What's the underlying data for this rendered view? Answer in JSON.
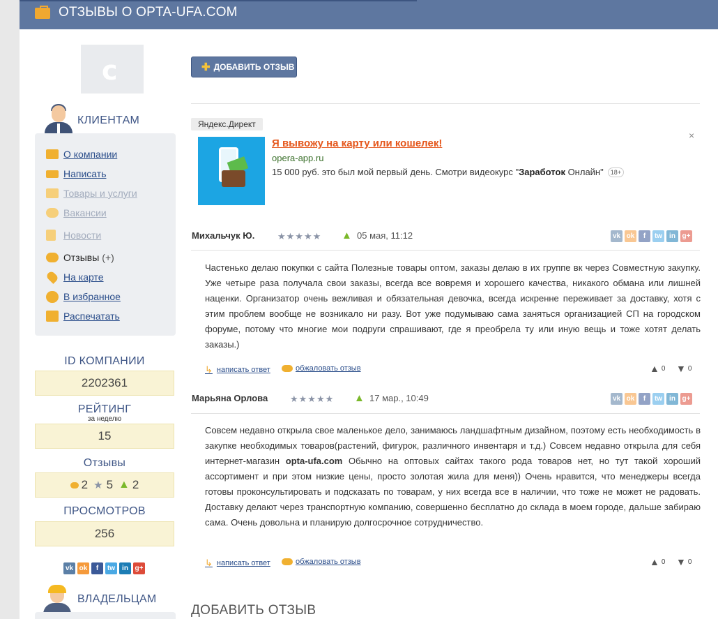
{
  "header": {
    "title": "ОТЗЫВЫ О OPTA-UFA.COM"
  },
  "logo": {
    "letter": "c"
  },
  "clients": {
    "title": "КЛИЕНТАМ",
    "items": [
      {
        "label": "О компании",
        "icon": "briefcase-icon",
        "state": "link"
      },
      {
        "label": "Написать",
        "icon": "envelope-icon",
        "state": "link"
      },
      {
        "label": "Товары и услуги",
        "icon": "camera-icon",
        "state": "disabled"
      },
      {
        "label": "Вакансии",
        "icon": "people-icon",
        "state": "disabled"
      },
      {
        "label": "Новости",
        "icon": "newspaper-icon",
        "state": "disabled"
      },
      {
        "label": "Отзывы",
        "count": "(+)",
        "icon": "chat-bubble-icon",
        "state": "current"
      },
      {
        "label": "На карте",
        "icon": "map-pin-icon",
        "state": "link"
      },
      {
        "label": "В избранное",
        "icon": "star-burst-icon",
        "state": "link"
      },
      {
        "label": "Распечатать",
        "icon": "printer-icon",
        "state": "link"
      }
    ]
  },
  "stats": {
    "id_label": "ID КОМПАНИИ",
    "id_value": "2202361",
    "rating_label": "РЕЙТИНГ",
    "rating_sub": "за неделю",
    "rating_value": "15",
    "reviews_label": "Отзывы",
    "reviews_comments": "2",
    "reviews_stars": "5",
    "reviews_likes": "2",
    "views_label": "ПРОСМОТРОВ",
    "views_value": "256"
  },
  "owners": {
    "title": "ВЛАДЕЛЬЦАМ"
  },
  "social": [
    "vk",
    "ok",
    "f",
    "tw",
    "in",
    "g+"
  ],
  "add_button": {
    "label": "ДОБАВИТЬ ОТЗЫВ"
  },
  "ad": {
    "tag": "Яндекс.Директ",
    "title": "Я вывожу на карту или кошелек!",
    "domain": "opera-app.ru",
    "text_before": "15 000 руб. это был мой первый день. Смотри видеокурс \"",
    "text_bold": "Заработок",
    "text_after": " Онлайн\"",
    "age": "18+",
    "close": "×"
  },
  "reviews": [
    {
      "author": "Михальчук Ю.",
      "stars": "★★★★★",
      "date": "05 мая, 11:12",
      "text": "Частенько делаю покупки с сайта Полезные товары оптом, заказы делаю в их группе вк через Совместную закупку. Уже четыре раза получала свои заказы, всегда все вовремя и хорошего качества, никакого обмана или лишней наценки. Организатор очень вежливая и обязательная девочка, всегда искренне переживает за доставку, хотя с этим проблем вообще не возникало ни разу. Вот уже подумываю сама заняться организацией СП на городском форуме, потому что многие мои подруги спрашивают, где я преобрела ту или иную вещь и тоже хотят делать заказы.)",
      "reply": "написать ответ",
      "discuss": "обжаловать отзыв",
      "likes": "0",
      "dislikes": "0"
    },
    {
      "author": "Марьяна Орлова",
      "stars": "★★★★★",
      "date": "17 мар., 10:49",
      "text_before": "Совсем недавно открыла свое маленькое дело, занимаюсь ландшафтным дизайном, поэтому есть необходимость в закупке необходимых товаров(растений, фигурок, различного инвентаря и т.д.) Совсем недавно открыла для себя интернет-магазин ",
      "text_bold": "opta-ufa.com",
      "text_after": " Обычно на оптовых сайтах такого рода товаров нет, но тут такой хороший ассортимент и при этом низкие цены, просто золотая жила для меня)) Очень нравится, что менеджеры всегда готовы проконсультировать и подсказать по товарам, у них всегда все в наличии, что тоже не может не радовать. Доставку делают через транспортную компанию, совершенно бесплатно до склада в моем городе, дальше забираю сама. Очень довольна и планирую долгосрочное сотрудничество.",
      "reply": "написать ответ",
      "discuss": "обжаловать отзыв",
      "likes": "0",
      "dislikes": "0"
    }
  ],
  "add_review_title": "ДОБАВИТЬ ОТЗЫВ"
}
